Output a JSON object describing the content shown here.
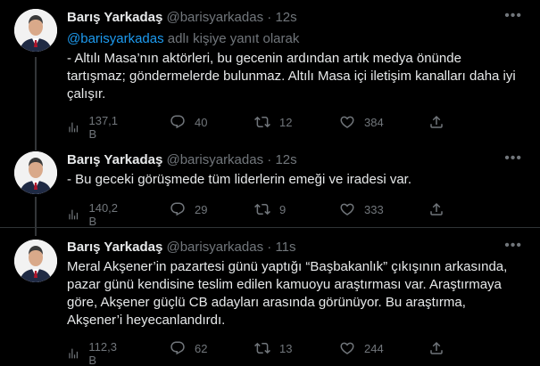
{
  "tweets": [
    {
      "name": "Barış Yarkadaş",
      "handle": "@barisyarkadas",
      "dot": "·",
      "time": "12s",
      "reply_mention": "@barisyarkadas",
      "reply_suffix": " adlı kişiye yanıt olarak",
      "lines": [
        "- Altılı Masa’nın aktörleri, bu gecenin ardından artık medya önünde",
        "tartışmaz; göndermelerde bulunmaz. Altılı Masa içi iletişim kanalları daha iyi",
        "çalışır."
      ],
      "views": "137,1 B",
      "replies": "40",
      "retweets": "12",
      "likes": "384"
    },
    {
      "name": "Barış Yarkadaş",
      "handle": "@barisyarkadas",
      "dot": "·",
      "time": "12s",
      "lines": [
        "- Bu geceki görüşmede tüm liderlerin emeği ve iradesi var."
      ],
      "views": "140,2 B",
      "replies": "29",
      "retweets": "9",
      "likes": "333"
    },
    {
      "name": "Barış Yarkadaş",
      "handle": "@barisyarkadas",
      "dot": "·",
      "time": "11s",
      "lines": [
        "Meral Akşener’in pazartesi günü yaptığı “Başbakanlık” çıkışının arkasında,",
        "pazar günü kendisine teslim edilen kamuoyu araştırması var. Araştırmaya",
        "göre, Akşener güçlü CB adayları arasında  görünüyor. Bu araştırma,",
        "Akşener’i heyecanlandırdı."
      ],
      "views": "112,3 B",
      "replies": "62",
      "retweets": "13",
      "likes": "244"
    }
  ],
  "icons": {
    "more": "more-horizontal-icon",
    "views": "analytics-icon",
    "reply": "reply-icon",
    "retweet": "retweet-icon",
    "like": "heart-icon",
    "share": "share-icon"
  },
  "colors": {
    "background": "#000000",
    "text": "#e7e9ea",
    "secondary": "#71767b",
    "link": "#1d9bf0",
    "divider": "#2f3336"
  }
}
